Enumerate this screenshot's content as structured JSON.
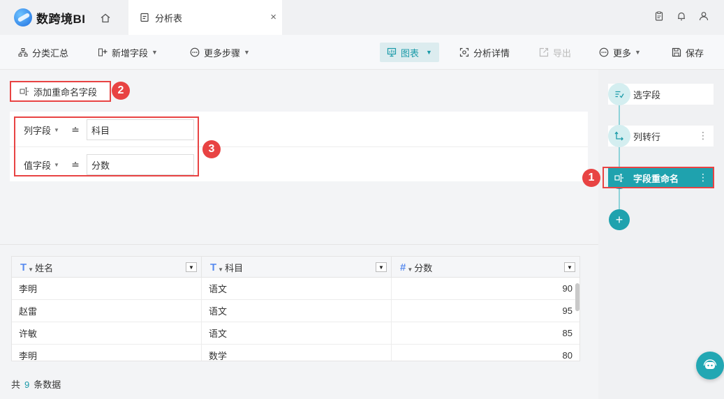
{
  "app": {
    "logo_text": "数跨境BI"
  },
  "tab": {
    "label": "分析表",
    "close": "×"
  },
  "toolbar": {
    "group_summary": "分类汇总",
    "add_field": "新增字段",
    "more_steps": "更多步骤",
    "chart": "图表",
    "analysis_detail": "分析详情",
    "export": "导出",
    "more": "更多",
    "save": "保存"
  },
  "config": {
    "add_rename_label": "添加重命名字段",
    "rows": [
      {
        "label": "列字段",
        "value": "科目"
      },
      {
        "label": "值字段",
        "value": "分数"
      }
    ],
    "operator": "≐"
  },
  "badges": {
    "one": "1",
    "two": "2",
    "three": "3"
  },
  "table": {
    "columns": [
      {
        "label": "姓名",
        "type_icon": "T"
      },
      {
        "label": "科目",
        "type_icon": "T"
      },
      {
        "label": "分数",
        "type_icon": "#"
      }
    ],
    "rows": [
      [
        "李明",
        "语文",
        "90"
      ],
      [
        "赵雷",
        "语文",
        "95"
      ],
      [
        "许敏",
        "语文",
        "85"
      ],
      [
        "李明",
        "数学",
        "80"
      ]
    ],
    "footer": {
      "prefix": "共",
      "count": "9",
      "suffix": "条数据"
    }
  },
  "flow": {
    "steps": [
      {
        "label": "选字段"
      },
      {
        "label": "列转行"
      },
      {
        "label": "字段重命名"
      }
    ],
    "add": "+"
  }
}
